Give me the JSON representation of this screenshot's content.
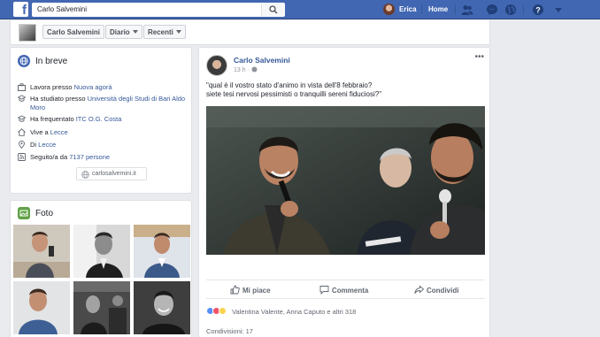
{
  "topbar": {
    "logo": "f",
    "search_value": "Carlo Salvemini",
    "user_name": "Erica",
    "home_label": "Home",
    "icons": [
      "search-icon",
      "friends-icon",
      "messenger-icon",
      "globe-icon",
      "help-icon",
      "dropdown-icon"
    ]
  },
  "profile_strip": {
    "name": "Carlo Salvemini",
    "diario_label": "Diario",
    "recenti_label": "Recenti"
  },
  "intro": {
    "title": "In breve",
    "rows": [
      {
        "icon": "briefcase-icon",
        "prefix": "Lavora presso ",
        "link": "Nuova agorà",
        "suffix": ""
      },
      {
        "icon": "graduation-cap-icon",
        "prefix": "Ha studiato presso ",
        "link": "Università degli Studi di Bari Aldo Moro",
        "suffix": ""
      },
      {
        "icon": "graduation-cap-icon",
        "prefix": "Ha frequentato ",
        "link": "ITC O.G. Costa",
        "suffix": ""
      },
      {
        "icon": "home-icon",
        "prefix": "Vive a ",
        "link": "Lecce",
        "suffix": ""
      },
      {
        "icon": "location-pin-icon",
        "prefix": "Di ",
        "link": "Lecce",
        "suffix": ""
      },
      {
        "icon": "rss-icon",
        "prefix": "Seguito/a da ",
        "link": "7137 persone",
        "suffix": ""
      }
    ],
    "website": "carlosalvemini.it"
  },
  "photos": {
    "title": "Foto"
  },
  "post": {
    "author": "Carlo Salvemini",
    "time": "13 h · ",
    "more": "•••",
    "text_line1": "\"qual è il vostro stato d'animo in vista dell'8 febbraio?",
    "text_line2": "siete tesi nervosi pessimisti o tranquilli sereni fiduciosi?\"",
    "actions": {
      "like": "Mi piace",
      "comment": "Commenta",
      "share": "Condividi"
    },
    "reactions_names": "Valentina Valente, Anna Caputo e altri 318",
    "shares": "Condivisioni: 17"
  },
  "colors": {
    "brand_blue": "#4267b2",
    "link": "#365899",
    "background": "#e9ebee"
  }
}
